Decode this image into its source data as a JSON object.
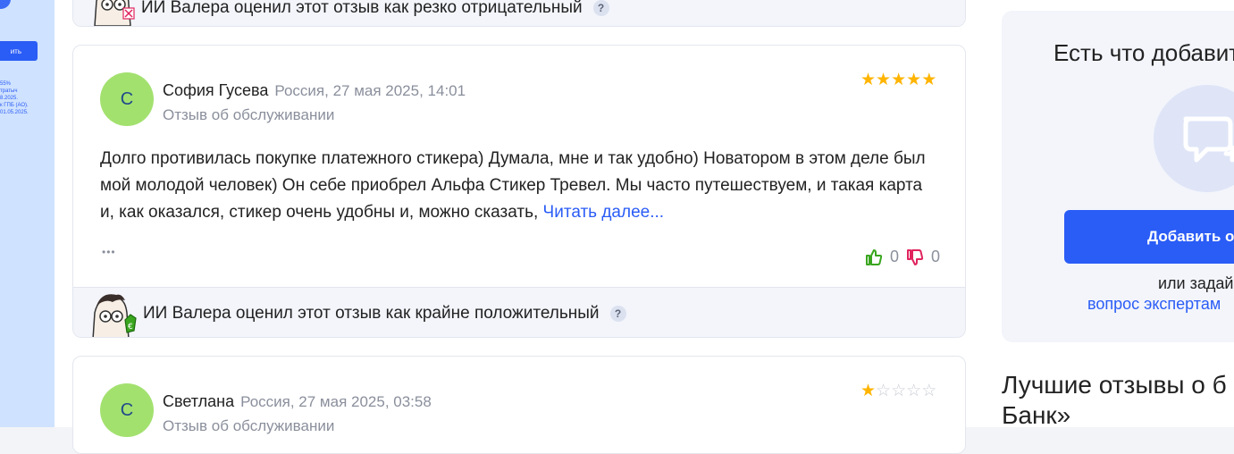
{
  "left_banner": {
    "button_label": "ить",
    "legal_lines": [
      "55%",
      "тратыч",
      "8.2025.",
      "к ГПБ (АО).",
      "01.05.2025."
    ]
  },
  "top_ai_bar": {
    "text": "ИИ Валера оценил этот отзыв как резко отрицательный",
    "help": "?"
  },
  "reviews": [
    {
      "avatar_letter": "С",
      "author": "София Гусева",
      "meta": "Россия, 27 мая 2025, 14:01",
      "type": "Отзыв об обслуживании",
      "rating": 5,
      "text": "Долго противилась покупке платежного стикера) Думала, мне и так удобно) Новатором в этом деле был мой молодой человек) Он себе приобрел Альфа Стикер Тревел. Мы часто путешествуем, и такая карта и, как оказался, стикер очень удобны и, можно сказать,",
      "read_more": "Читать далее...",
      "more": "•••",
      "likes": "0",
      "dislikes": "0",
      "ai_text": "ИИ Валера оценил этот отзыв как крайне положительный",
      "ai_help": "?"
    },
    {
      "avatar_letter": "С",
      "author": "Светлана",
      "meta": "Россия, 27 мая 2025, 03:58",
      "type": "Отзыв об обслуживании",
      "rating": 1
    }
  ],
  "sidebar": {
    "add_title": "Есть что добавит",
    "add_button": "Добавить от",
    "or_ask": "или задай",
    "experts_link": "вопрос экспертам",
    "best_title_line1": "Лучшие отзывы о б",
    "best_title_line2": "Банк»"
  },
  "colors": {
    "accent": "#2a5cf6",
    "avatar": "#a3e16f",
    "star": "#ffb400",
    "like": "#3aa61f",
    "dislike": "#e0245e"
  }
}
